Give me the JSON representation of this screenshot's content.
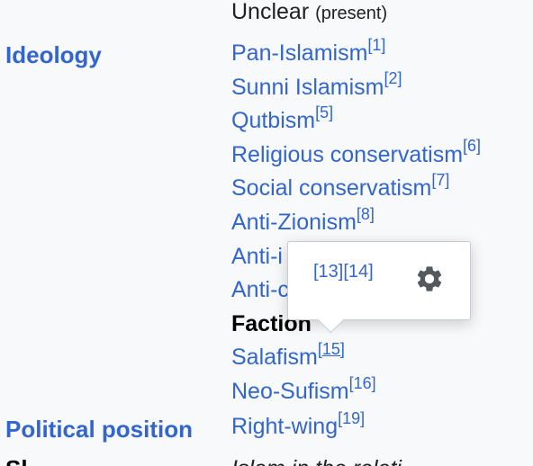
{
  "prev_row": {
    "value_main": "Unclear",
    "value_note": "(present)"
  },
  "ideology": {
    "label": "Ideology",
    "items": [
      {
        "text": "Pan-Islamism",
        "ref": "[1]"
      },
      {
        "text": "Sunni Islamism",
        "ref": "[2]"
      },
      {
        "text": "Qutbism",
        "ref": "[5]"
      },
      {
        "text": "Religious conservatism",
        "ref": "[6]"
      },
      {
        "text": "Social conservatism",
        "ref": "[7]"
      },
      {
        "text": "Anti-Zionism",
        "ref": "[8]"
      },
      {
        "text": "Anti-i",
        "ref": ""
      },
      {
        "text": "Anti-c",
        "ref": ""
      }
    ],
    "factions_heading": "Faction",
    "factions": [
      {
        "text": "Salafism",
        "ref": "[15]"
      },
      {
        "text": "Neo-Sufism",
        "ref": "[16]"
      }
    ]
  },
  "political_position": {
    "label": "Political position",
    "value": "Right-wing",
    "ref": "[19]"
  },
  "next_row": {
    "label": "Sl",
    "value": "Islam in the relati"
  },
  "popup": {
    "refs": "[13][14]",
    "icon": "gear-icon"
  }
}
